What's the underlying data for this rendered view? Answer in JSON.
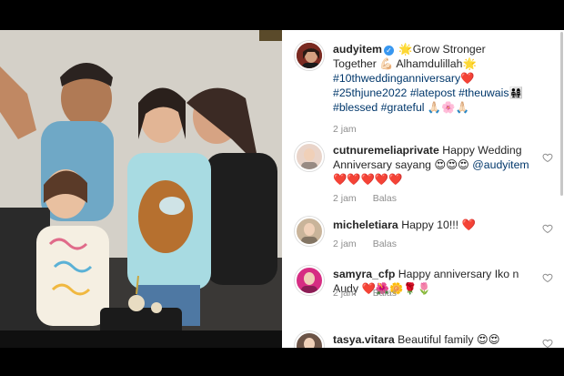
{
  "post": {
    "username": "audyitem",
    "caption_parts": [
      {
        "text": "🌟Grow Stronger Together 💪🏻 Alhamdulillah🌟 ",
        "tag": false
      },
      {
        "text": "#10thweddinganniversary",
        "tag": true
      },
      {
        "text": "❤️ ",
        "tag": false
      },
      {
        "text": "#25thjune2022",
        "tag": true
      },
      {
        "text": " ",
        "tag": false
      },
      {
        "text": "#latepost",
        "tag": true
      },
      {
        "text": " ",
        "tag": false
      },
      {
        "text": "#theuwais",
        "tag": true
      },
      {
        "text": "👨‍👩‍👧‍👧 ",
        "tag": false
      },
      {
        "text": "#blessed",
        "tag": true
      },
      {
        "text": " ",
        "tag": false
      },
      {
        "text": "#grateful",
        "tag": true
      },
      {
        "text": " 🙏🏻🌸🙏🏻",
        "tag": false
      }
    ],
    "time": "2 jam"
  },
  "comments": [
    {
      "username": "cutnuremeliaprivate",
      "text": "Happy Wedding Anniversary sayang 😍😍😍 ",
      "mention": "@audyitem",
      "after": " ❤️❤️❤️❤️❤️",
      "time": "2 jam",
      "reply": "Balas",
      "avatar_color": "#e9d4c9"
    },
    {
      "username": "micheletiara",
      "text": "Happy 10!!! ❤️",
      "mention": "",
      "after": "",
      "time": "2 jam",
      "reply": "Balas",
      "avatar_color": "#c9b49a"
    },
    {
      "username": "samyra_cfp",
      "text": "Happy anniversary Iko n Audy ❤️🌺🌼🌹🌷",
      "mention": "",
      "after": "",
      "time": "2 jam",
      "reply": "Balas",
      "avatar_color": "#d62d83"
    },
    {
      "username": "tasya.vitara",
      "text": "Beautiful family 😍😍",
      "mention": "",
      "after": "",
      "time": "",
      "reply": "",
      "avatar_color": "#6b5346"
    }
  ],
  "colors": {
    "link": "#00376b",
    "verified": "#3897f0",
    "muted": "#8e8e8e"
  }
}
